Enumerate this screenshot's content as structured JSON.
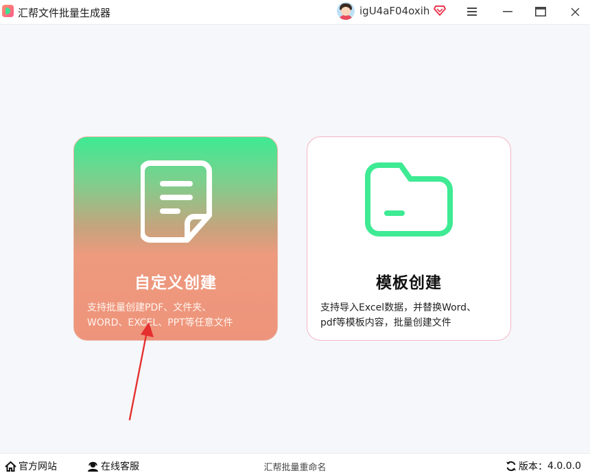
{
  "window": {
    "title": "汇帮文件批量生成器",
    "username": "igU4aF04oxih"
  },
  "cards": {
    "custom": {
      "title": "自定义创建",
      "desc_line1": "支持批量创建PDF、文件夹、",
      "desc_line2": "WORD、EXCEL、PPT等任意文件"
    },
    "template": {
      "title": "模板创建",
      "desc_line1": "支持导入Excel数据，并替换Word、",
      "desc_line2": "pdf等模板内容，批量创建文件"
    }
  },
  "footer": {
    "website": "官方网站",
    "support": "在线客服",
    "center_text": "汇帮批量重命名",
    "version_label": "版本：",
    "version": "4.0.0.0"
  },
  "colors": {
    "accent_green": "#3eea93",
    "card_salmon": "#ee947c",
    "vip_red": "#e8384f",
    "arrow_red": "#e53030"
  },
  "icons": [
    "app-logo-icon",
    "user-avatar",
    "vip-diamond-icon",
    "menu-icon",
    "minimize-icon",
    "maximize-icon",
    "close-icon",
    "document-icon",
    "folder-icon",
    "home-icon",
    "headset-icon",
    "refresh-icon"
  ]
}
